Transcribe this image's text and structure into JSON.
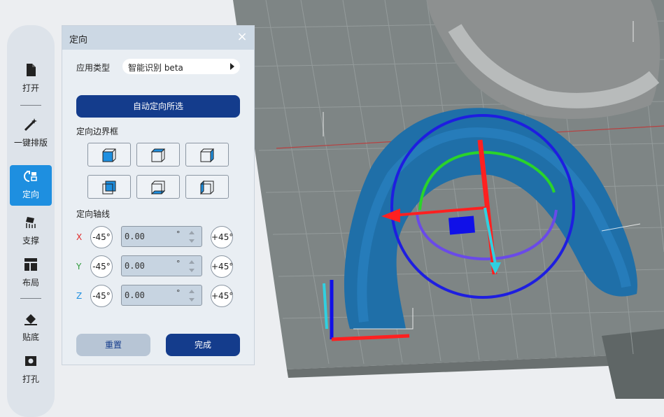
{
  "toolbar": {
    "items": [
      {
        "label": "打开",
        "icon": "file-icon"
      },
      {
        "label": "一键排版",
        "icon": "magic-wand-icon"
      },
      {
        "label": "定向",
        "icon": "orient-icon"
      },
      {
        "label": "支撑",
        "icon": "support-icon"
      },
      {
        "label": "布局",
        "icon": "layout-icon"
      },
      {
        "label": "贴底",
        "icon": "eraser-icon"
      },
      {
        "label": "打孔",
        "icon": "hole-icon"
      }
    ],
    "active_color": "#1e8fe0"
  },
  "panel": {
    "title": "定向",
    "close_icon": "×",
    "app_type_label": "应用类型",
    "app_type_value": "智能识别 beta",
    "auto_orient_button": "自动定向所选",
    "bbox_label": "定向边界框",
    "axis_section_label": "定向轴线",
    "axes": [
      {
        "name": "X",
        "minus": "-45°",
        "value": "0.00",
        "unit": "°",
        "plus": "+45°",
        "color": "#e02a2a"
      },
      {
        "name": "Y",
        "minus": "-45°",
        "value": "0.00",
        "unit": "°",
        "plus": "+45°",
        "color": "#2e9a3a"
      },
      {
        "name": "Z",
        "minus": "-45°",
        "value": "0.00",
        "unit": "°",
        "plus": "+45°",
        "color": "#1e8fe0"
      }
    ],
    "reset_button": "重置",
    "done_button": "完成"
  },
  "colors": {
    "primary": "#143c8c",
    "model": "#1f6fa8",
    "plate": "#7e8585"
  }
}
